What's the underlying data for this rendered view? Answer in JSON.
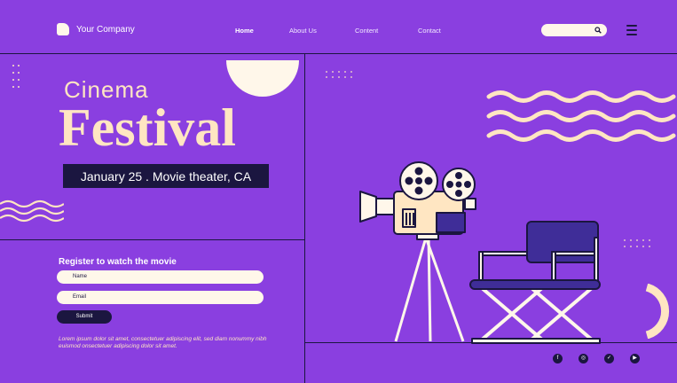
{
  "header": {
    "brand": "Your Company",
    "nav": [
      {
        "label": "Home",
        "active": true
      },
      {
        "label": "About Us",
        "active": false
      },
      {
        "label": "Content",
        "active": false
      },
      {
        "label": "Contact",
        "active": false
      }
    ],
    "search_placeholder": "",
    "search_icon": "search-icon",
    "menu_icon": "hamburger-menu-icon"
  },
  "hero": {
    "title_small": "Cinema",
    "title_large": "Festival",
    "date_line": "January 25 . Movie theater, CA"
  },
  "register": {
    "title": "Register to watch the movie",
    "name_placeholder": "Name",
    "email_placeholder": "Email",
    "submit_label": "Submit",
    "body": "Lorem ipsum dolor sit amet, consectetuer adipiscing elit, sed diam nonummy nibh euismod onsectetuer adipiscing dolor sit amet."
  },
  "social": [
    {
      "icon": "facebook-icon",
      "glyph": "f"
    },
    {
      "icon": "instagram-icon",
      "glyph": "◎"
    },
    {
      "icon": "twitter-icon",
      "glyph": "✓"
    },
    {
      "icon": "youtube-icon",
      "glyph": "▶"
    }
  ],
  "colors": {
    "background": "#8a3fe0",
    "dark": "#1b1640",
    "cream": "#ffe6c2",
    "chair": "#3f2d98"
  }
}
